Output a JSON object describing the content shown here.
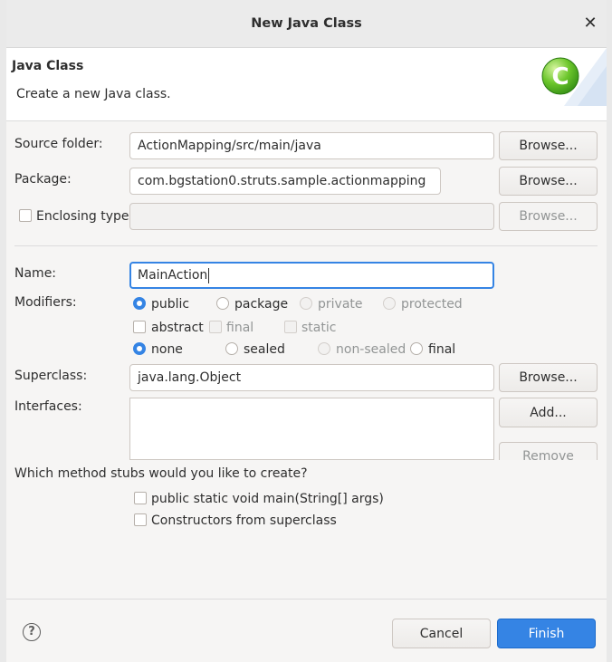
{
  "dialog": {
    "title": "New Java Class",
    "close_icon": "close-icon"
  },
  "banner": {
    "title": "Java Class",
    "description": "Create a new Java class."
  },
  "form": {
    "source_folder": {
      "label": "Source folder:",
      "value": "ActionMapping/src/main/java",
      "browse": "Browse..."
    },
    "package": {
      "label": "Package:",
      "value": "com.bgstation0.struts.sample.actionmapping",
      "browse": "Browse..."
    },
    "enclosing": {
      "label": "Enclosing type:",
      "value": "",
      "browse": "Browse..."
    },
    "name": {
      "label": "Name:",
      "value": "MainAction"
    },
    "modifiers": {
      "label": "Modifiers:",
      "access": [
        "public",
        "package",
        "private",
        "protected"
      ],
      "flags": [
        "abstract",
        "final",
        "static"
      ],
      "inheritance": [
        "none",
        "sealed",
        "non-sealed",
        "final"
      ]
    },
    "superclass": {
      "label": "Superclass:",
      "value": "java.lang.Object",
      "browse": "Browse..."
    },
    "interfaces": {
      "label": "Interfaces:",
      "add": "Add...",
      "remove": "Remove"
    },
    "stubs": {
      "question": "Which method stubs would you like to create?",
      "main": "public static void main(String[] args)",
      "constructors": "Constructors from superclass"
    }
  },
  "footer": {
    "help": "?",
    "cancel": "Cancel",
    "finish": "Finish"
  },
  "colors": {
    "accent": "#3584e4",
    "background": "#f6f5f4"
  }
}
